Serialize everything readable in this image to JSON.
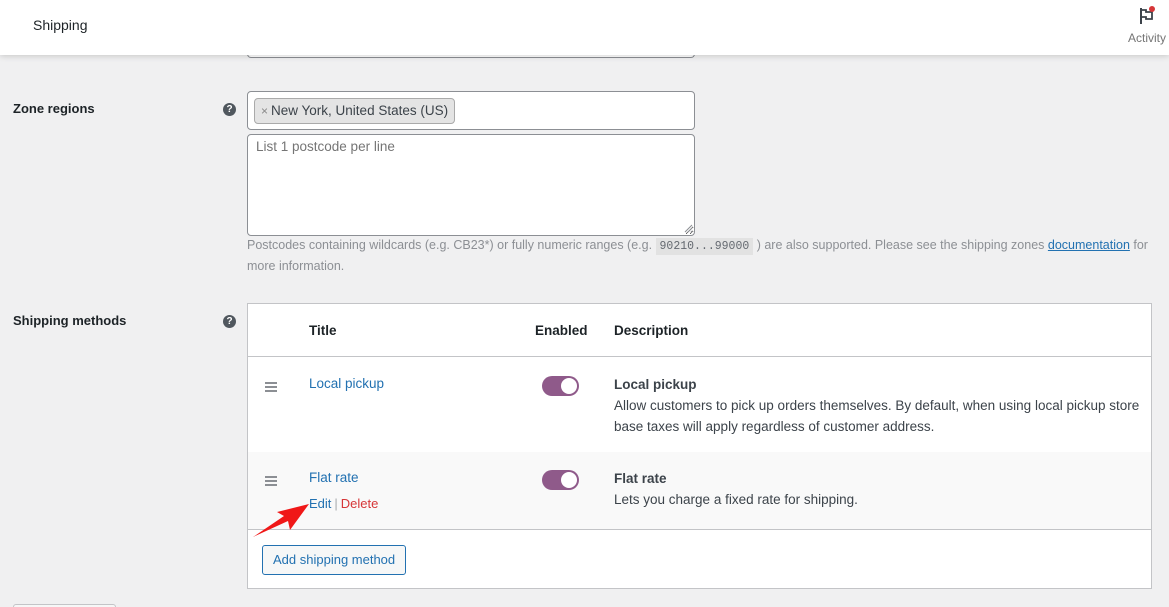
{
  "header": {
    "title": "Shipping",
    "activity_label": "Activity",
    "activity_icon": "flag-icon",
    "activity_has_notification": true
  },
  "zone_regions": {
    "label": "Zone regions",
    "help_icon": "question-circle-icon",
    "selected_regions": [
      {
        "remove_symbol": "×",
        "label": "New York, United States (US)"
      }
    ],
    "postcodes_value": "",
    "postcodes_placeholder": "List 1 postcode per line",
    "hint": {
      "prefix": "Postcodes containing wildcards (e.g. CB23*) or fully numeric ranges (e.g. ",
      "code": "90210...99000",
      "middle": " ) are also supported. Please see the shipping zones ",
      "link": "documentation",
      "suffix": " for more information."
    }
  },
  "shipping_methods": {
    "label": "Shipping methods",
    "help_icon": "question-circle-icon",
    "columns": {
      "title": "Title",
      "enabled": "Enabled",
      "description": "Description"
    },
    "rows": [
      {
        "title": "Local pickup",
        "enabled": true,
        "description_title": "Local pickup",
        "description": "Allow customers to pick up orders themselves. By default, when using local pickup store base taxes will apply regardless of customer address.",
        "actions": null
      },
      {
        "title": "Flat rate",
        "enabled": true,
        "description_title": "Flat rate",
        "description": "Lets you charge a fixed rate for shipping.",
        "actions": {
          "edit": "Edit",
          "separator": "|",
          "delete": "Delete"
        }
      }
    ],
    "add_button": "Add shipping method"
  },
  "colors": {
    "link": "#2271b1",
    "delete": "#d63638",
    "toggle_on": "#8f5a8a",
    "annotation_arrow": "#f01818"
  }
}
